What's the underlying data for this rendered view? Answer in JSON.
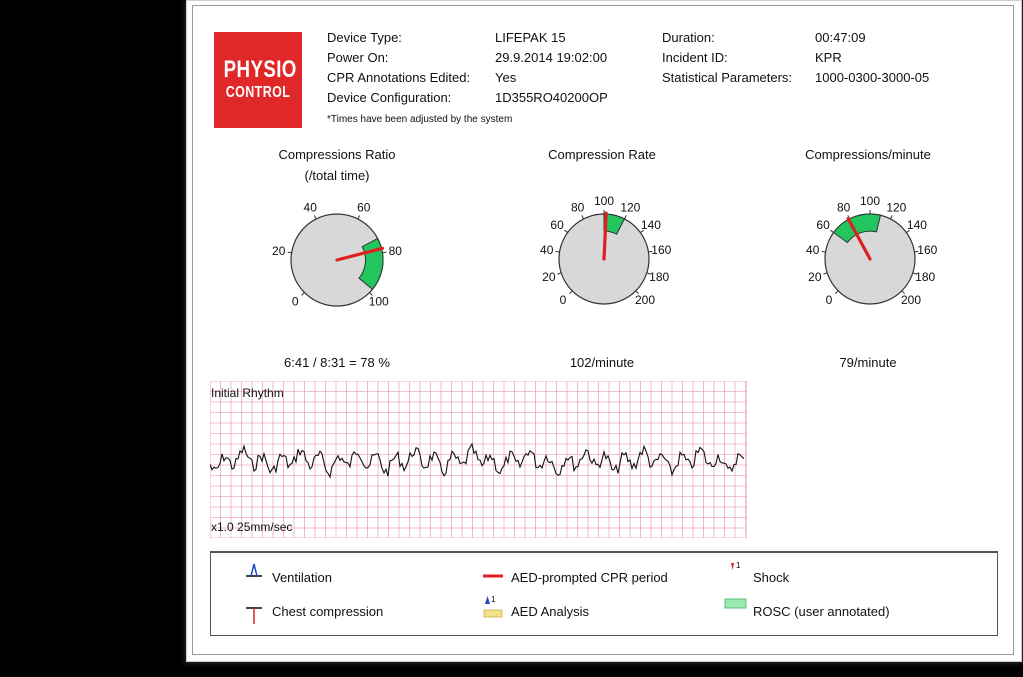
{
  "logo": {
    "line1": "PHYSIO",
    "line2": "CONTROL",
    "color": "#e02828"
  },
  "info_left": [
    {
      "label": "Device Type:",
      "value": "LIFEPAK 15"
    },
    {
      "label": "Power On:",
      "value": "29.9.2014 19:02:00"
    },
    {
      "label": "CPR Annotations Edited:",
      "value": "Yes"
    },
    {
      "label": "Device Configuration:",
      "value": "1D355RO40200OP"
    }
  ],
  "info_right": [
    {
      "label": "Duration:",
      "value": "00:47:09"
    },
    {
      "label": "Incident ID:",
      "value": "KPR"
    },
    {
      "label": "Statistical Parameters:",
      "value": "1000-0300-3000-05"
    }
  ],
  "note": "*Times have been adjusted by the system",
  "gauges": [
    {
      "title": "Compressions Ratio",
      "subtitle": "(/total time)",
      "ticks": [
        "0",
        "20",
        "40",
        "60",
        "80",
        "100"
      ],
      "max": 100,
      "value": 78,
      "green_range": [
        73,
        98
      ],
      "reading": "6:41 / 8:31 = 78 %"
    },
    {
      "title": "Compression Rate",
      "subtitle": "",
      "ticks": [
        "0",
        "20",
        "40",
        "60",
        "80",
        "100",
        "120",
        "140",
        "160",
        "180",
        "200"
      ],
      "max": 200,
      "value": 102,
      "green_range": [
        100,
        120
      ],
      "reading": "102/minute"
    },
    {
      "title": "Compressions/minute",
      "subtitle": "",
      "ticks": [
        "0",
        "20",
        "40",
        "60",
        "80",
        "100",
        "120",
        "140",
        "160",
        "180",
        "200"
      ],
      "max": 200,
      "value": 79,
      "green_range": [
        60,
        110
      ],
      "reading": "79/minute"
    }
  ],
  "ecg": {
    "label": "Initial Rhythm",
    "scale": "x1.0 25mm/sec",
    "grid_color": "#f0a8c8"
  },
  "legend": {
    "ventilation": "Ventilation",
    "chest_compression": "Chest compression",
    "aed_prompted": "AED-prompted CPR period",
    "aed_analysis": "AED Analysis",
    "shock": "Shock",
    "rosc": "ROSC (user annotated)"
  },
  "colors": {
    "needle": "#e02020",
    "green": "#22c55e",
    "dial": "#d8d8d8"
  }
}
